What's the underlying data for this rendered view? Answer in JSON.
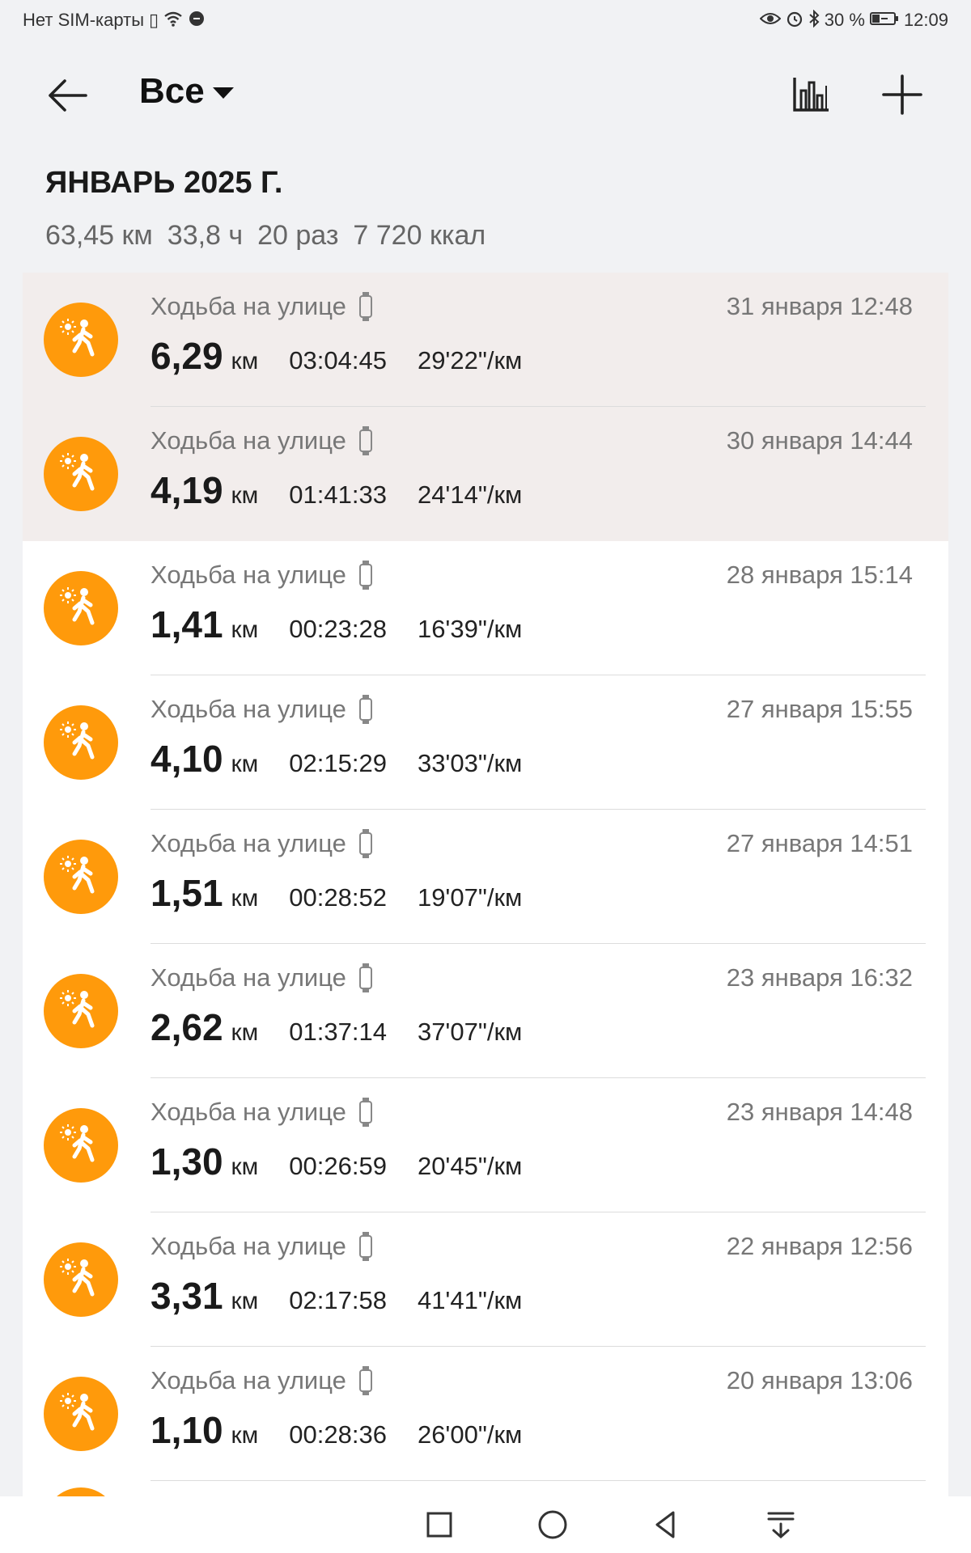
{
  "status": {
    "carrier": "Нет SIM-карты",
    "battery": "30 %",
    "time": "12:09"
  },
  "header": {
    "title": "Все"
  },
  "month": {
    "title": "ЯНВАРЬ 2025 Г.",
    "distance": "63,45 км",
    "duration": "33,8 ч",
    "count": "20 раз",
    "calories": "7 720 ккал"
  },
  "workouts": [
    {
      "name": "Ходьба на улице",
      "date": "31 января 12:48",
      "distance": "6,29",
      "unit": "км",
      "duration": "03:04:45",
      "pace": "29'22\"/км"
    },
    {
      "name": "Ходьба на улице",
      "date": "30 января 14:44",
      "distance": "4,19",
      "unit": "км",
      "duration": "01:41:33",
      "pace": "24'14\"/км"
    },
    {
      "name": "Ходьба на улице",
      "date": "28 января 15:14",
      "distance": "1,41",
      "unit": "км",
      "duration": "00:23:28",
      "pace": "16'39\"/км"
    },
    {
      "name": "Ходьба на улице",
      "date": "27 января 15:55",
      "distance": "4,10",
      "unit": "км",
      "duration": "02:15:29",
      "pace": "33'03\"/км"
    },
    {
      "name": "Ходьба на улице",
      "date": "27 января 14:51",
      "distance": "1,51",
      "unit": "км",
      "duration": "00:28:52",
      "pace": "19'07\"/км"
    },
    {
      "name": "Ходьба на улице",
      "date": "23 января 16:32",
      "distance": "2,62",
      "unit": "км",
      "duration": "01:37:14",
      "pace": "37'07\"/км"
    },
    {
      "name": "Ходьба на улице",
      "date": "23 января 14:48",
      "distance": "1,30",
      "unit": "км",
      "duration": "00:26:59",
      "pace": "20'45\"/км"
    },
    {
      "name": "Ходьба на улице",
      "date": "22 января 12:56",
      "distance": "3,31",
      "unit": "км",
      "duration": "02:17:58",
      "pace": "41'41\"/км"
    },
    {
      "name": "Ходьба на улице",
      "date": "20 января 13:06",
      "distance": "1,10",
      "unit": "км",
      "duration": "00:28:36",
      "pace": "26'00\"/км"
    }
  ],
  "colors": {
    "accent": "#ff9a0b",
    "highlight_row": "#f2edec",
    "background": "#f1f2f4"
  },
  "icons": {
    "back": "arrow-left-icon",
    "dropdown": "caret-down-icon",
    "stats": "bar-chart-icon",
    "add": "plus-icon",
    "workout": "outdoor-walk-icon",
    "device": "watch-icon"
  }
}
